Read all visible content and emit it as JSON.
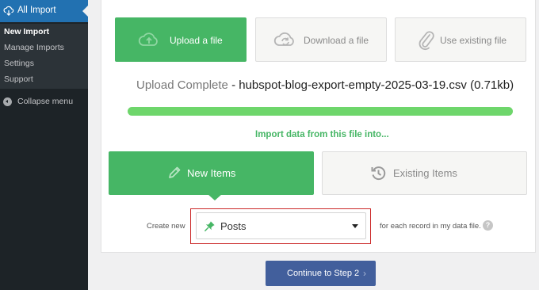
{
  "sidebar": {
    "title": "All Import",
    "items": [
      {
        "label": "New Import"
      },
      {
        "label": "Manage Imports"
      },
      {
        "label": "Settings"
      },
      {
        "label": "Support"
      }
    ],
    "collapse_label": "Collapse menu"
  },
  "source_options": {
    "upload": "Upload a file",
    "download": "Download a file",
    "existing": "Use existing file"
  },
  "upload_status": {
    "state": "Upload Complete",
    "separator": " - ",
    "filename": "hubspot-blog-export-empty-2025-03-19.csv",
    "size": "(0.71kb)",
    "progress_percent": 100
  },
  "import_into_label": "Import data from this file into...",
  "item_types": {
    "new": "New Items",
    "existing": "Existing Items"
  },
  "create_row": {
    "prefix": "Create new",
    "selected_type": "Posts",
    "suffix": "for each record in my data file.",
    "help_glyph": "?"
  },
  "continue_button": {
    "label": "Continue to Step 2",
    "chevron": "›"
  },
  "colors": {
    "accent_green": "#46b665",
    "progress_green": "#6ed66b",
    "continue_blue": "#425f9c",
    "sidebar_active": "#2271b1",
    "highlight_red": "#cc2a2a"
  },
  "icons": {
    "plugin": "cloud-import-icon",
    "upload": "cloud-upload-icon",
    "download": "cloud-sync-icon",
    "existing": "paperclip-icon",
    "new_items": "pencil-icon",
    "existing_items": "history-icon",
    "post_type": "pushpin-icon"
  }
}
